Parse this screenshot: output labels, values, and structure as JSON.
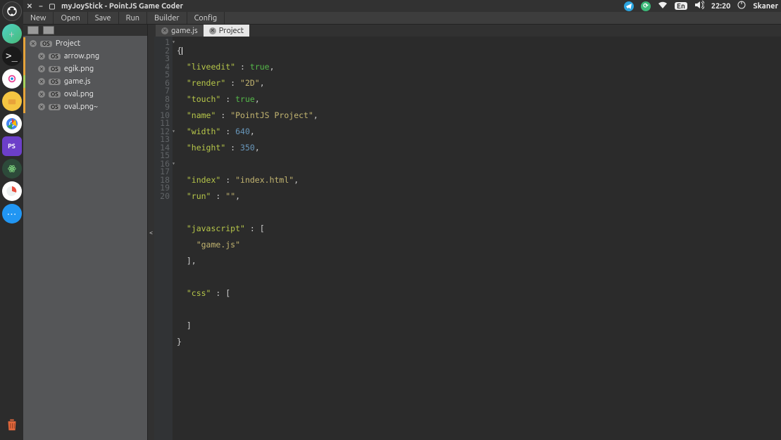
{
  "titlebar": {
    "title": "myJoyStick - PointJS Game Coder",
    "tray_lang": "En",
    "tray_time": "22:20",
    "tray_user": "Skaner"
  },
  "menubar": [
    "New",
    "Open",
    "Save",
    "Run",
    "Builder",
    "Config"
  ],
  "filetree": {
    "root": "Project",
    "items": [
      "arrow.png",
      "egik.png",
      "game.js",
      "oval.png",
      "oval.png~"
    ],
    "active_index": 2
  },
  "tabs": [
    {
      "label": "game.js",
      "active": false
    },
    {
      "label": "Project",
      "active": true
    }
  ],
  "code_lines": 20,
  "fold_lines": [
    1,
    12,
    16
  ],
  "code": {
    "l1": "{",
    "l2_k": "\"liveedit\"",
    "l2_v": "true",
    "l3_k": "\"render\"",
    "l3_v": "\"2D\"",
    "l4_k": "\"touch\"",
    "l4_v": "true",
    "l5_k": "\"name\"",
    "l5_v": "\"PointJS Project\"",
    "l6_k": "\"width\"",
    "l6_v": "640",
    "l7_k": "\"height\"",
    "l7_v": "350",
    "l9_k": "\"index\"",
    "l9_v": "\"index.html\"",
    "l10_k": "\"run\"",
    "l10_v": "\"\"",
    "l12_k": "\"javascript\"",
    "l13_v": "\"game.js\"",
    "l14": "],",
    "l16_k": "\"css\"",
    "l18": "]",
    "l19": "}"
  },
  "chart_data": null
}
